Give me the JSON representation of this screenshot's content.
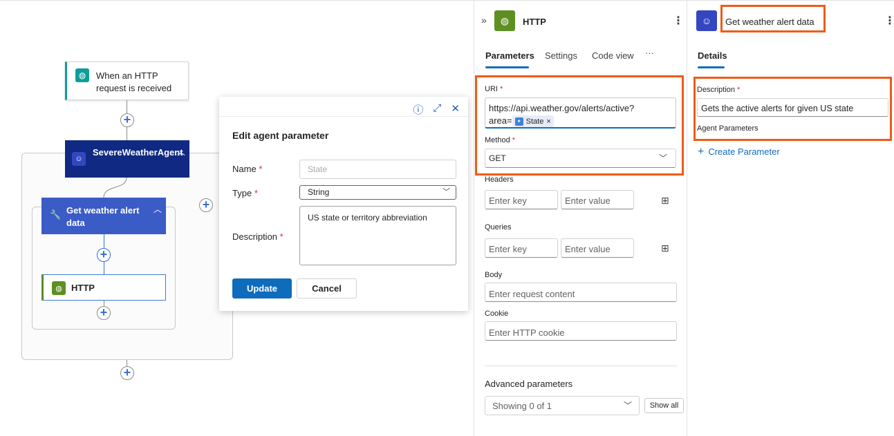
{
  "canvas": {
    "trigger_label": "When an HTTP request is received",
    "agent_label": "SevereWeatherAgent",
    "tool_label": "Get weather alert data",
    "http_action_label": "HTTP"
  },
  "edit_parameter": {
    "title": "Edit agent parameter",
    "name_label": "Name",
    "name_placeholder": "State",
    "type_label": "Type",
    "type_value": "String",
    "description_label": "Description",
    "description_value": "US state or territory abbreviation",
    "update_button": "Update",
    "cancel_button": "Cancel"
  },
  "http_pane": {
    "title": "HTTP",
    "tabs": [
      "Parameters",
      "Settings",
      "Code view",
      "···"
    ],
    "uri_label": "URI",
    "uri_text_1": "https://api.weather.gov/alerts/active?",
    "uri_text_2": "area=",
    "uri_token": "State",
    "method_label": "Method",
    "method_value": "GET",
    "headers_label": "Headers",
    "queries_label": "Queries",
    "key_placeholder": "Enter key",
    "value_placeholder": "Enter value",
    "body_label": "Body",
    "body_placeholder": "Enter request content",
    "cookie_label": "Cookie",
    "cookie_placeholder": "Enter HTTP cookie",
    "advanced_label": "Advanced parameters",
    "advanced_select": "Showing 0 of 1",
    "show_all_button": "Show all"
  },
  "details_pane": {
    "title": "Get weather alert data",
    "tab": "Details",
    "description_label": "Description",
    "description_value": "Gets the active alerts for given US state",
    "agent_params_label": "Agent Parameters",
    "create_parameter": "Create Parameter"
  },
  "colors": {
    "accent": "#0f6cbd",
    "highlight": "#f05a16",
    "agent_node": "#102a83",
    "tool_node": "#3b5bc6",
    "http_icon": "#5e8f22",
    "trigger_icon": "#0f9d9a"
  }
}
